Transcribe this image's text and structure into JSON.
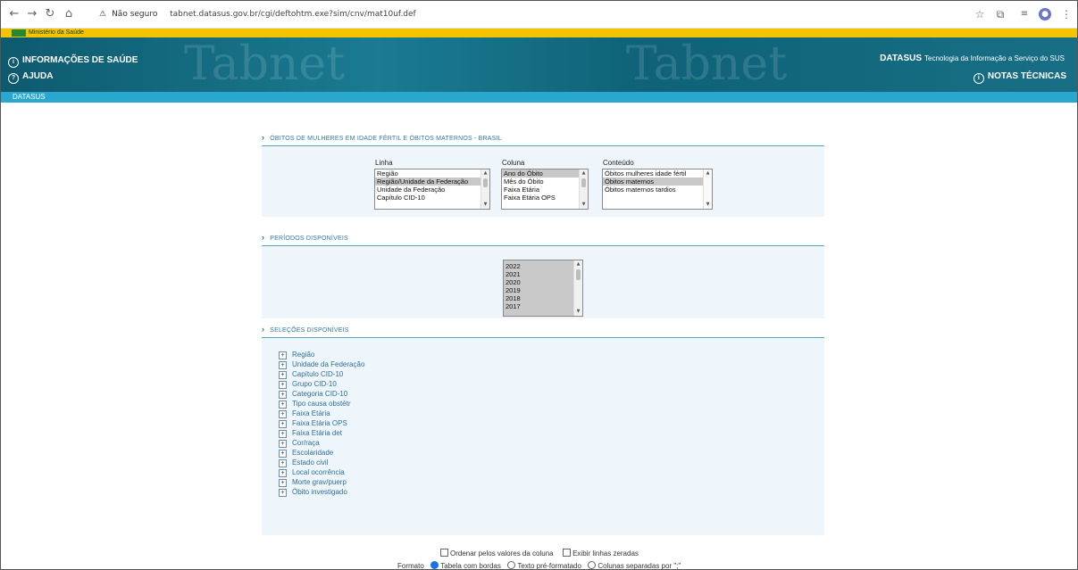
{
  "browser": {
    "security_label": "Não seguro",
    "url": "tabnet.datasus.gov.br/cgi/deftohtm.exe?sim/cnv/mat10uf.def"
  },
  "ministry": {
    "label": "Ministério da Saúde"
  },
  "header": {
    "info_link": "INFORMAÇÕES DE SAÚDE",
    "help_link": "AJUDA",
    "watermark_left": "Tabnet",
    "watermark_right": "Tabnet",
    "brand_name": "DATASUS",
    "brand_tagline": "Tecnologia da Informação a Serviço do SUS",
    "notes_link": "NOTAS TÉCNICAS"
  },
  "navstrip": {
    "label": "DATASUS"
  },
  "form": {
    "title": "ÓBITOS DE MULHERES EM IDADE FÉRTIL E ÓBITOS MATERNOS - BRASIL",
    "linha": {
      "label": "Linha",
      "options": [
        "Região",
        "Região/Unidade da Federação",
        "Unidade da Federação",
        "Capítulo CID-10"
      ],
      "selected": "Região/Unidade da Federação"
    },
    "coluna": {
      "label": "Coluna",
      "options": [
        "Ano do Óbito",
        "Mês do Óbito",
        "Faixa Etária",
        "Faixa Etária OPS"
      ],
      "selected": "Ano do Óbito"
    },
    "conteudo": {
      "label": "Conteúdo",
      "options": [
        "Óbitos mulheres idade fértil",
        "Óbitos maternos",
        "Óbitos maternos tardios"
      ],
      "selected": "Óbitos maternos"
    },
    "periods_title": "PERÍODOS DISPONÍVEIS",
    "periods": [
      "2022",
      "2021",
      "2020",
      "2019",
      "2018",
      "2017"
    ],
    "selections_title": "SELEÇÕES DISPONÍVEIS",
    "selections": [
      "Região",
      "Unidade da Federação",
      "Capítulo CID-10",
      "Grupo CID-10",
      "Categoria CID-10",
      "Tipo causa obstétr",
      "Faixa Etária",
      "Faixa Etária OPS",
      "Faixa Etária det",
      "Cor/raça",
      "Escolaridade",
      "Estado civil",
      "Local ocorrência",
      "Morte grav/puerp",
      "Óbito investigado"
    ],
    "sort_label": "Ordenar pelos valores da coluna",
    "zero_label": "Exibir linhas zeradas",
    "format_label": "Formato",
    "format_options": [
      "Tabela com bordas",
      "Texto pré-formatado",
      "Colunas separadas por \";\""
    ],
    "format_selected": "Tabela com bordas"
  }
}
